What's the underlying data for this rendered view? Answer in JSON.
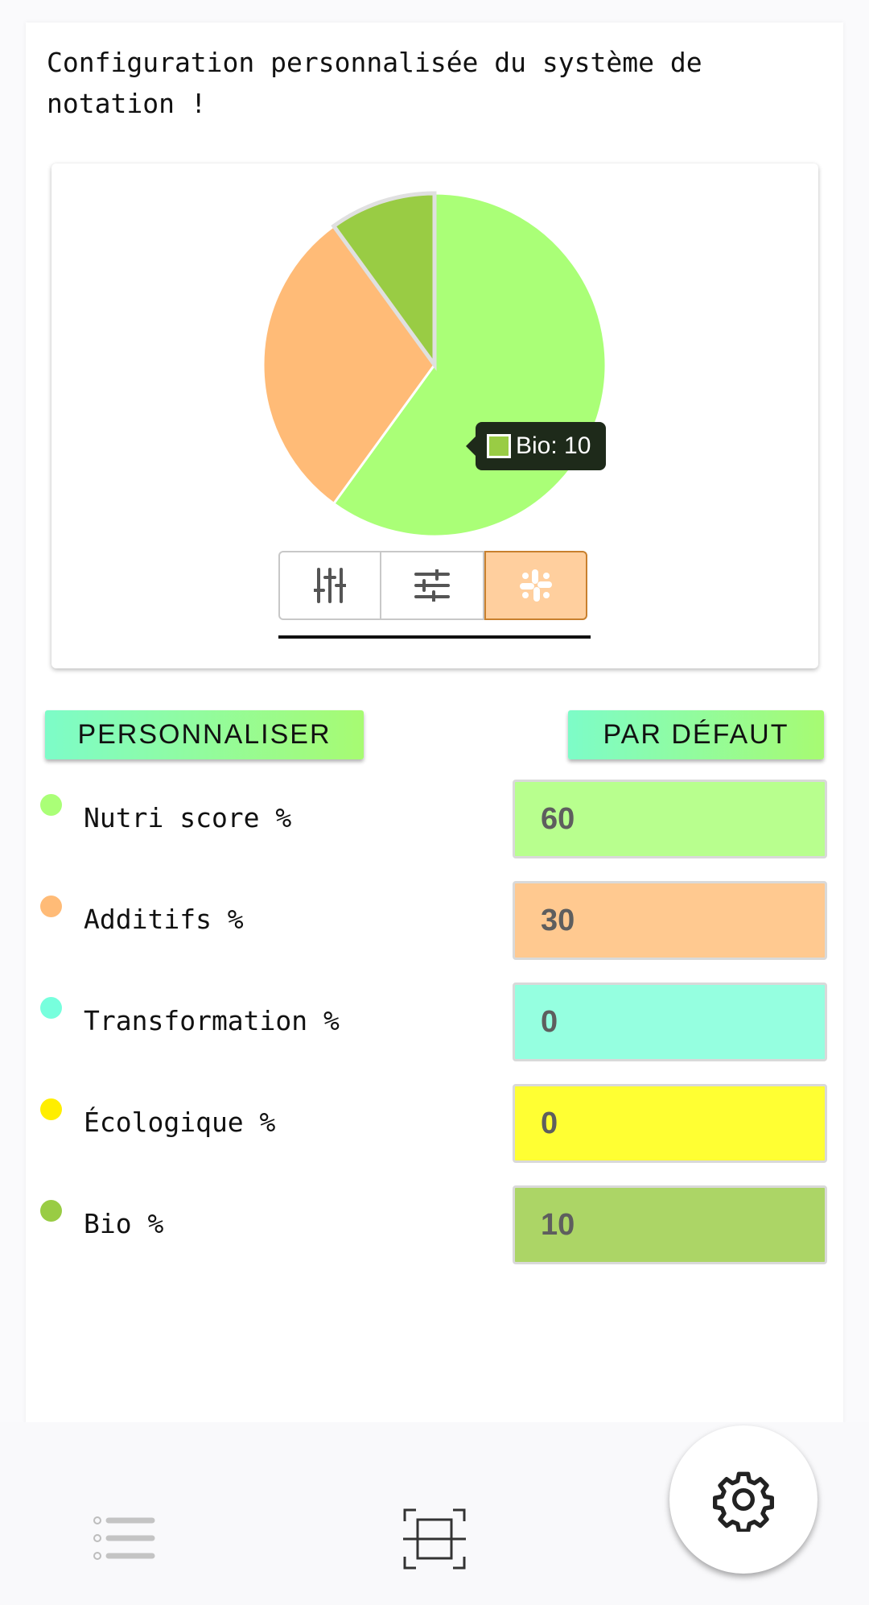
{
  "header": {
    "title": "Configuration personnalisée du système de notation !"
  },
  "chart_data": {
    "type": "pie",
    "categories": [
      "Nutri score",
      "Additifs",
      "Transformation",
      "Écologique",
      "Bio"
    ],
    "values": [
      60,
      30,
      0,
      0,
      10
    ],
    "colors": [
      "#aaff77",
      "#ffbb77",
      "#77ffdd",
      "#ffff00",
      "#99cc44"
    ],
    "tooltip": {
      "label": "Bio: 10",
      "series": "Bio"
    }
  },
  "chart_view_toggle": {
    "options": [
      {
        "icon": "vertical-sliders-icon",
        "active": false
      },
      {
        "icon": "horizontal-sliders-icon",
        "active": false
      },
      {
        "icon": "pie-chart-icon",
        "active": true
      }
    ]
  },
  "actions": {
    "personalize_label": "PERSONNALISER",
    "default_label": "PAR DÉFAUT"
  },
  "criteria": [
    {
      "label": "Nutri score %",
      "value": "60",
      "color": "#aaff77",
      "field_color": "#b8ff8e"
    },
    {
      "label": "Additifs %",
      "value": "30",
      "color": "#ffbb77",
      "field_color": "#ffc990"
    },
    {
      "label": "Transformation %",
      "value": "0",
      "color": "#77ffdd",
      "field_color": "#95ffe0"
    },
    {
      "label": "Écologique %",
      "value": "0",
      "color": "#ffee00",
      "field_color": "#ffff33"
    },
    {
      "label": "Bio %",
      "value": "10",
      "color": "#99cc44",
      "field_color": "#acd566"
    }
  ],
  "bottom_nav": {
    "items": [
      {
        "icon": "list-icon"
      },
      {
        "icon": "barcode-scan-icon"
      },
      {
        "icon": "gear-icon",
        "active": true
      }
    ]
  }
}
